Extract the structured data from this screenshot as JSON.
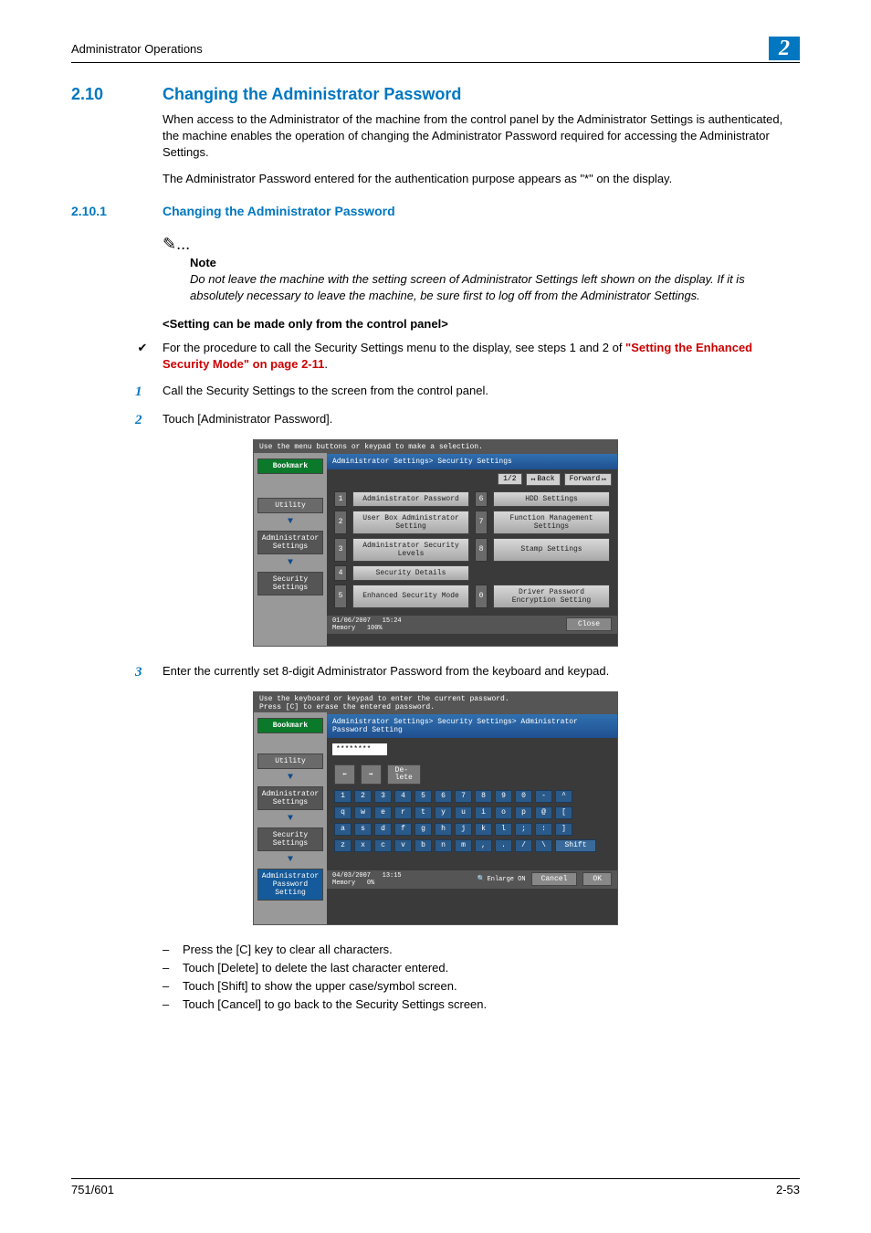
{
  "header": {
    "title": "Administrator Operations",
    "chapter": "2"
  },
  "section": {
    "num": "2.10",
    "title": "Changing the Administrator Password"
  },
  "subsection": {
    "num": "2.10.1",
    "title": "Changing the Administrator Password"
  },
  "para1": "When access to the Administrator of the machine from the control panel by the Administrator Settings is authenticated, the machine enables the operation of changing the Administrator Password required for accessing the Administrator Settings.",
  "para2": "The Administrator Password entered for the authentication purpose appears as \"*\" on the display.",
  "note": {
    "label": "Note",
    "text": "Do not leave the machine with the setting screen of Administrator Settings left shown on the display. If it is absolutely necessary to leave the machine, be sure first to log off from the Administrator Settings."
  },
  "setting_line": "<Setting can be made only from the control panel>",
  "proc_intro_prefix": "For the procedure to call the Security Settings menu to the display, see steps 1 and 2 of ",
  "proc_intro_link": "\"Setting the Enhanced Security Mode\" on page 2-11",
  "proc_intro_suffix": ".",
  "steps": {
    "n1": "1",
    "t1": "Call the Security Settings to the screen from the control panel.",
    "n2": "2",
    "t2": "Touch [Administrator Password].",
    "n3": "3",
    "t3": "Enter the currently set 8-digit Administrator Password from the keyboard and keypad."
  },
  "substeps": {
    "a": "Press the [C] key to clear all characters.",
    "b": "Touch [Delete] to delete the last character entered.",
    "c": "Touch [Shift] to show the upper case/symbol screen.",
    "d": "Touch [Cancel] to go back to the Security Settings screen."
  },
  "screenshot1": {
    "top": "Use the menu buttons or keypad to make a selection.",
    "breadcrumb": "Administrator Settings> Security Settings",
    "page": "1/2",
    "back": "Back",
    "forward": "Forward",
    "sidebar": {
      "bookmark": "Bookmark",
      "utility": "Utility",
      "admin": "Administrator\nSettings",
      "security": "Security\nSettings"
    },
    "items": {
      "1n": "1",
      "1l": "Administrator Password",
      "2n": "2",
      "2l": "User Box Administrator Setting",
      "3n": "3",
      "3l": "Administrator Security Levels",
      "4n": "4",
      "4l": "Security Details",
      "5n": "5",
      "5l": "Enhanced Security Mode",
      "6n": "6",
      "6l": "HDD Settings",
      "7n": "7",
      "7l": "Function Management Settings",
      "8n": "8",
      "8l": "Stamp Settings",
      "0n": "0",
      "0l": "Driver Password Encryption Setting"
    },
    "footer_date": "01/06/2007",
    "footer_time": "15:24",
    "footer_mem": "Memory",
    "footer_pct": "100%",
    "close": "Close"
  },
  "screenshot2": {
    "top1": "Use the keyboard or keypad to enter the current password.",
    "top2": "Press [C] to erase the entered password.",
    "breadcrumb": "Administrator Settings> Security Settings> Administrator Password Setting",
    "password": "********",
    "delete": "De-\nlete",
    "sidebar": {
      "bookmark": "Bookmark",
      "utility": "Utility",
      "admin": "Administrator\nSettings",
      "security": "Security\nSettings",
      "adminpw": "Administrator\nPassword Setting"
    },
    "rows": {
      "r1": [
        "1",
        "2",
        "3",
        "4",
        "5",
        "6",
        "7",
        "8",
        "9",
        "0",
        "-",
        "^"
      ],
      "r2": [
        "q",
        "w",
        "e",
        "r",
        "t",
        "y",
        "u",
        "i",
        "o",
        "p",
        "@",
        "["
      ],
      "r3": [
        "a",
        "s",
        "d",
        "f",
        "g",
        "h",
        "j",
        "k",
        "l",
        ";",
        ":",
        "]"
      ],
      "r4": [
        "z",
        "x",
        "c",
        "v",
        "b",
        "n",
        "m",
        ",",
        ".",
        "/",
        "\\"
      ]
    },
    "shift": "Shift",
    "footer_date": "04/03/2007",
    "footer_time": "13:15",
    "footer_mem": "Memory",
    "footer_pct": "0%",
    "enlarge": "Enlarge ON",
    "cancel": "Cancel",
    "ok": "OK"
  },
  "footer": {
    "left": "751/601",
    "right": "2-53"
  }
}
